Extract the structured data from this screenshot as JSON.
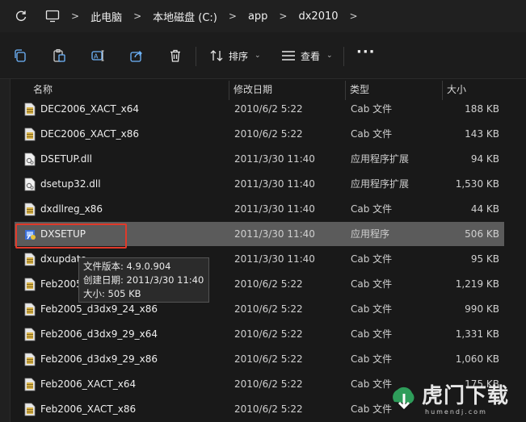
{
  "breadcrumb": [
    "此电脑",
    "本地磁盘 (C:)",
    "app",
    "dx2010"
  ],
  "toolbar": {
    "sort_label": "排序",
    "view_label": "查看",
    "more": "···"
  },
  "columns": {
    "name": "名称",
    "date": "修改日期",
    "type": "类型",
    "size": "大小"
  },
  "files": [
    {
      "name": "DEC2006_XACT_x64",
      "date": "2010/6/2 5:22",
      "type": "Cab 文件",
      "size": "188 KB",
      "icon": "cab-file-icon"
    },
    {
      "name": "DEC2006_XACT_x86",
      "date": "2010/6/2 5:22",
      "type": "Cab 文件",
      "size": "143 KB",
      "icon": "cab-file-icon"
    },
    {
      "name": "DSETUP.dll",
      "date": "2011/3/30 11:40",
      "type": "应用程序扩展",
      "size": "94 KB",
      "icon": "dll-file-icon"
    },
    {
      "name": "dsetup32.dll",
      "date": "2011/3/30 11:40",
      "type": "应用程序扩展",
      "size": "1,530 KB",
      "icon": "dll-file-icon"
    },
    {
      "name": "dxdllreg_x86",
      "date": "2011/3/30 11:40",
      "type": "Cab 文件",
      "size": "44 KB",
      "icon": "cab-file-icon"
    },
    {
      "name": "DXSETUP",
      "date": "2011/3/30 11:40",
      "type": "应用程序",
      "size": "506 KB",
      "icon": "setup-app-icon",
      "selected": true
    },
    {
      "name": "dxupdate",
      "date": "2011/3/30 11:40",
      "type": "Cab 文件",
      "size": "95 KB",
      "icon": "cab-file-icon"
    },
    {
      "name": "Feb2005_d3dx9_24_x64",
      "date": "2010/6/2 5:22",
      "type": "Cab 文件",
      "size": "1,219 KB",
      "icon": "cab-file-icon"
    },
    {
      "name": "Feb2005_d3dx9_24_x86",
      "date": "2010/6/2 5:22",
      "type": "Cab 文件",
      "size": "990 KB",
      "icon": "cab-file-icon"
    },
    {
      "name": "Feb2006_d3dx9_29_x64",
      "date": "2010/6/2 5:22",
      "type": "Cab 文件",
      "size": "1,331 KB",
      "icon": "cab-file-icon"
    },
    {
      "name": "Feb2006_d3dx9_29_x86",
      "date": "2010/6/2 5:22",
      "type": "Cab 文件",
      "size": "1,060 KB",
      "icon": "cab-file-icon"
    },
    {
      "name": "Feb2006_XACT_x64",
      "date": "2010/6/2 5:22",
      "type": "Cab 文件",
      "size": "175 KB",
      "icon": "cab-file-icon"
    },
    {
      "name": "Feb2006_XACT_x86",
      "date": "2010/6/2 5:22",
      "type": "Cab 文件",
      "size": "",
      "icon": "cab-file-icon"
    }
  ],
  "tooltip": {
    "version": "文件版本: 4.9.0.904",
    "created": "创建日期: 2011/3/30 11:40",
    "size": "大小: 505 KB"
  },
  "watermark": {
    "text": "虎门下载",
    "sub": "humendj.com"
  },
  "colors": {
    "selection": "#5b5b5b",
    "highlight_box": "#e03a2a",
    "background": "#191919"
  }
}
